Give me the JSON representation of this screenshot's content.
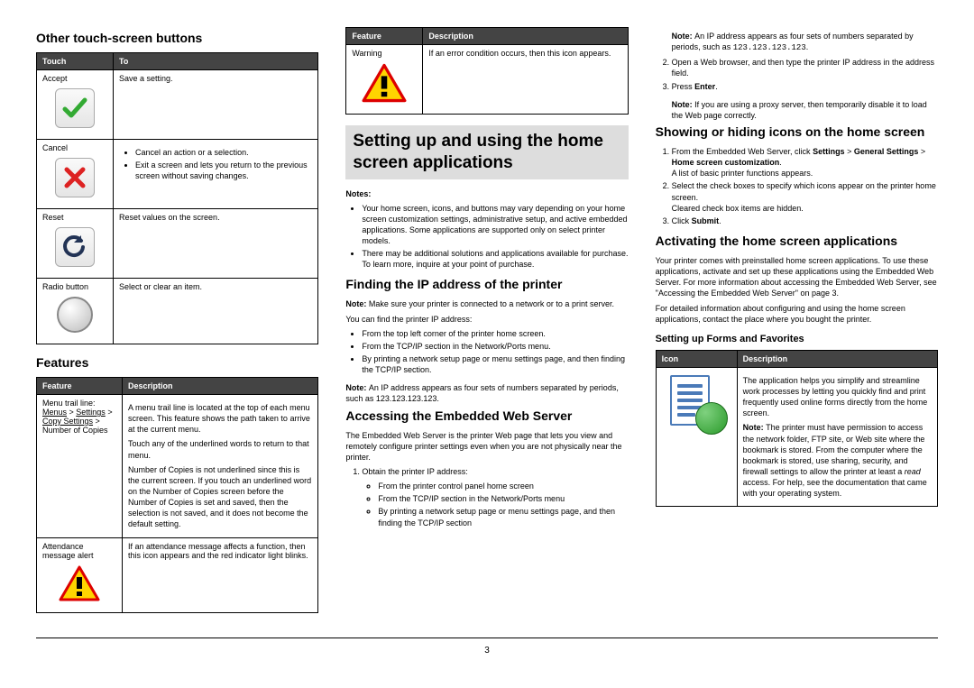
{
  "page_number": "3",
  "col1": {
    "h_other_buttons": "Other touch-screen buttons",
    "table_buttons": {
      "head_touch": "Touch",
      "head_to": "To",
      "r1_touch": "Accept",
      "r1_to": "Save a setting.",
      "r2_touch": "Cancel",
      "r2_to_a": "Cancel an action or a selection.",
      "r2_to_b": "Exit a screen and lets you return to the previous screen without saving changes.",
      "r3_touch": "Reset",
      "r3_to": "Reset values on the screen.",
      "r4_touch": "Radio button",
      "r4_to": "Select or clear an item."
    },
    "h_features": "Features",
    "table_features": {
      "head_feature": "Feature",
      "head_desc": "Description",
      "r1_feature_a": "Menu trail line:",
      "r1_feature_b1": "Menus",
      "r1_feature_b2": "Settings",
      "r1_feature_b3": "Copy Settings",
      "r1_feature_c": "Number of Copies",
      "r1_desc_p1": "A menu trail line is located at the top of each menu screen. This feature shows the path taken to arrive at the current menu.",
      "r1_desc_p2": "Touch any of the underlined words to return to that menu.",
      "r1_desc_p3": "Number of Copies is not underlined since this is the current screen. If you touch an underlined word on the Number of Copies screen before the Number of Copies is set and saved, then the selection is not saved, and it does not become the default setting.",
      "r2_feature": "Attendance message alert",
      "r2_desc": "If an attendance message affects a function, then this icon appears and the red indicator light blinks."
    }
  },
  "col2": {
    "table_warning": {
      "head_feature": "Feature",
      "head_desc": "Description",
      "r1_feature": "Warning",
      "r1_desc": "If an error condition occurs, then this icon appears."
    },
    "band": "Setting up and using the home screen applications",
    "notes_label": "Notes:",
    "notes_li1": "Your home screen, icons, and buttons may vary depending on your home screen customization settings, administrative setup, and active embedded applications. Some applications are supported only on select printer models.",
    "notes_li2": "There may be additional solutions and applications available for purchase. To learn more, inquire at your point of purchase.",
    "h_find_ip": "Finding the IP address of the printer",
    "find_ip_note": "Make sure your printer is connected to a network or to a print server.",
    "find_ip_lead": "You can find the printer IP address:",
    "find_ip_li1": "From the top left corner of the printer home screen.",
    "find_ip_li2": "From the TCP/IP section in the Network/Ports menu.",
    "find_ip_li3": "By printing a network setup page or menu settings page, and then finding the TCP/IP section.",
    "find_ip_note2": "An IP address appears as four sets of numbers separated by periods, such as 123.123.123.123.",
    "h_ews": "Accessing the Embedded Web Server",
    "ews_p": "The Embedded Web Server is the printer Web page that lets you view and remotely configure printer settings even when you are not physically near the printer.",
    "ews_li1": "Obtain the printer IP address:",
    "ews_li1a": "From the printer control panel home screen",
    "ews_li1b": "From the TCP/IP section in the Network/Ports menu",
    "ews_li1c": "By printing a network setup page or menu settings page, and then finding the TCP/IP section"
  },
  "col3": {
    "top_note_pre": "An IP address appears as four sets of numbers separated by periods, such as ",
    "top_note_ip": "123.123.123.123",
    "li2": "Open a Web browser, and then type the printer IP address in the address field.",
    "li3_pre": "Press ",
    "li3_b": "Enter",
    "proxy_note": "If you are using a proxy server, then temporarily disable it to load the Web page correctly.",
    "h_show_hide": "Showing or hiding icons on the home screen",
    "sh_li1_a": "From the Embedded Web Server, click ",
    "sh_li1_b1": "Settings",
    "sh_li1_b2": "General Settings",
    "sh_li1_b3": "Home screen customization",
    "sh_li1_tail": "A list of basic printer functions appears.",
    "sh_li2": "Select the check boxes to specify which icons appear on the printer home screen.",
    "sh_li2_tail": "Cleared check box items are hidden.",
    "sh_li3_a": "Click ",
    "sh_li3_b": "Submit",
    "h_activating": "Activating the home screen applications",
    "act_p1": "Your printer comes with preinstalled home screen applications. To use these applications, activate and set up these applications using the Embedded Web Server. For more information about accessing the Embedded Web Server, see \"Accessing the Embedded Web Server\" on page 3.",
    "act_p2": "For detailed information about configuring and using the home screen applications, contact the place where you bought the printer.",
    "h_forms": "Setting up Forms and Favorites",
    "table_forms": {
      "head_icon": "Icon",
      "head_desc": "Description",
      "desc_p1": "The application helps you simplify and streamline work processes by letting you quickly find and print frequently used online forms directly from the home screen.",
      "desc_p2_pre": "The printer must have permission to access the network folder, FTP site, or Web site where the bookmark is stored. From the computer where the bookmark is stored, use sharing, security, and firewall settings to allow the printer at least a ",
      "desc_p2_em": "read",
      "desc_p2_post": " access. For help, see the documentation that came with your operating system."
    }
  }
}
